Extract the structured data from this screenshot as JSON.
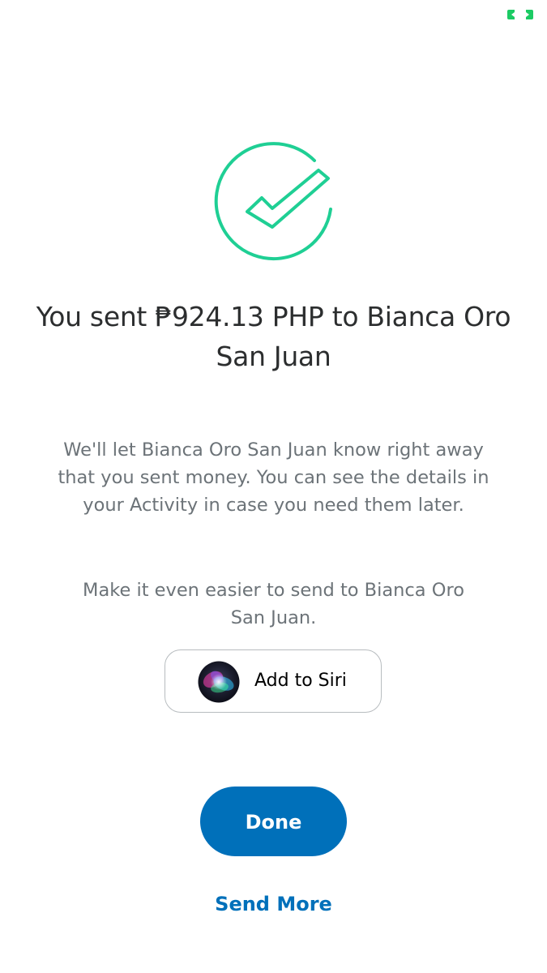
{
  "status_indicator": {
    "icon": "camera-indicator-icon",
    "color": "#1ccb64"
  },
  "success": {
    "icon": "checkmark-circle-icon",
    "color": "#1fcf94"
  },
  "headline": "You sent ₱924.13 PHP to Bianca Oro San Juan",
  "message": "We'll let Bianca Oro San Juan know right away that you sent money. You can see the details in your Activity in case you need them later.",
  "siri": {
    "prompt": "Make it even easier to send to Bianca Oro San Juan.",
    "button_label": "Add to Siri",
    "icon": "siri-icon"
  },
  "actions": {
    "done_label": "Done",
    "send_more_label": "Send More",
    "accent_color": "#0070ba"
  }
}
